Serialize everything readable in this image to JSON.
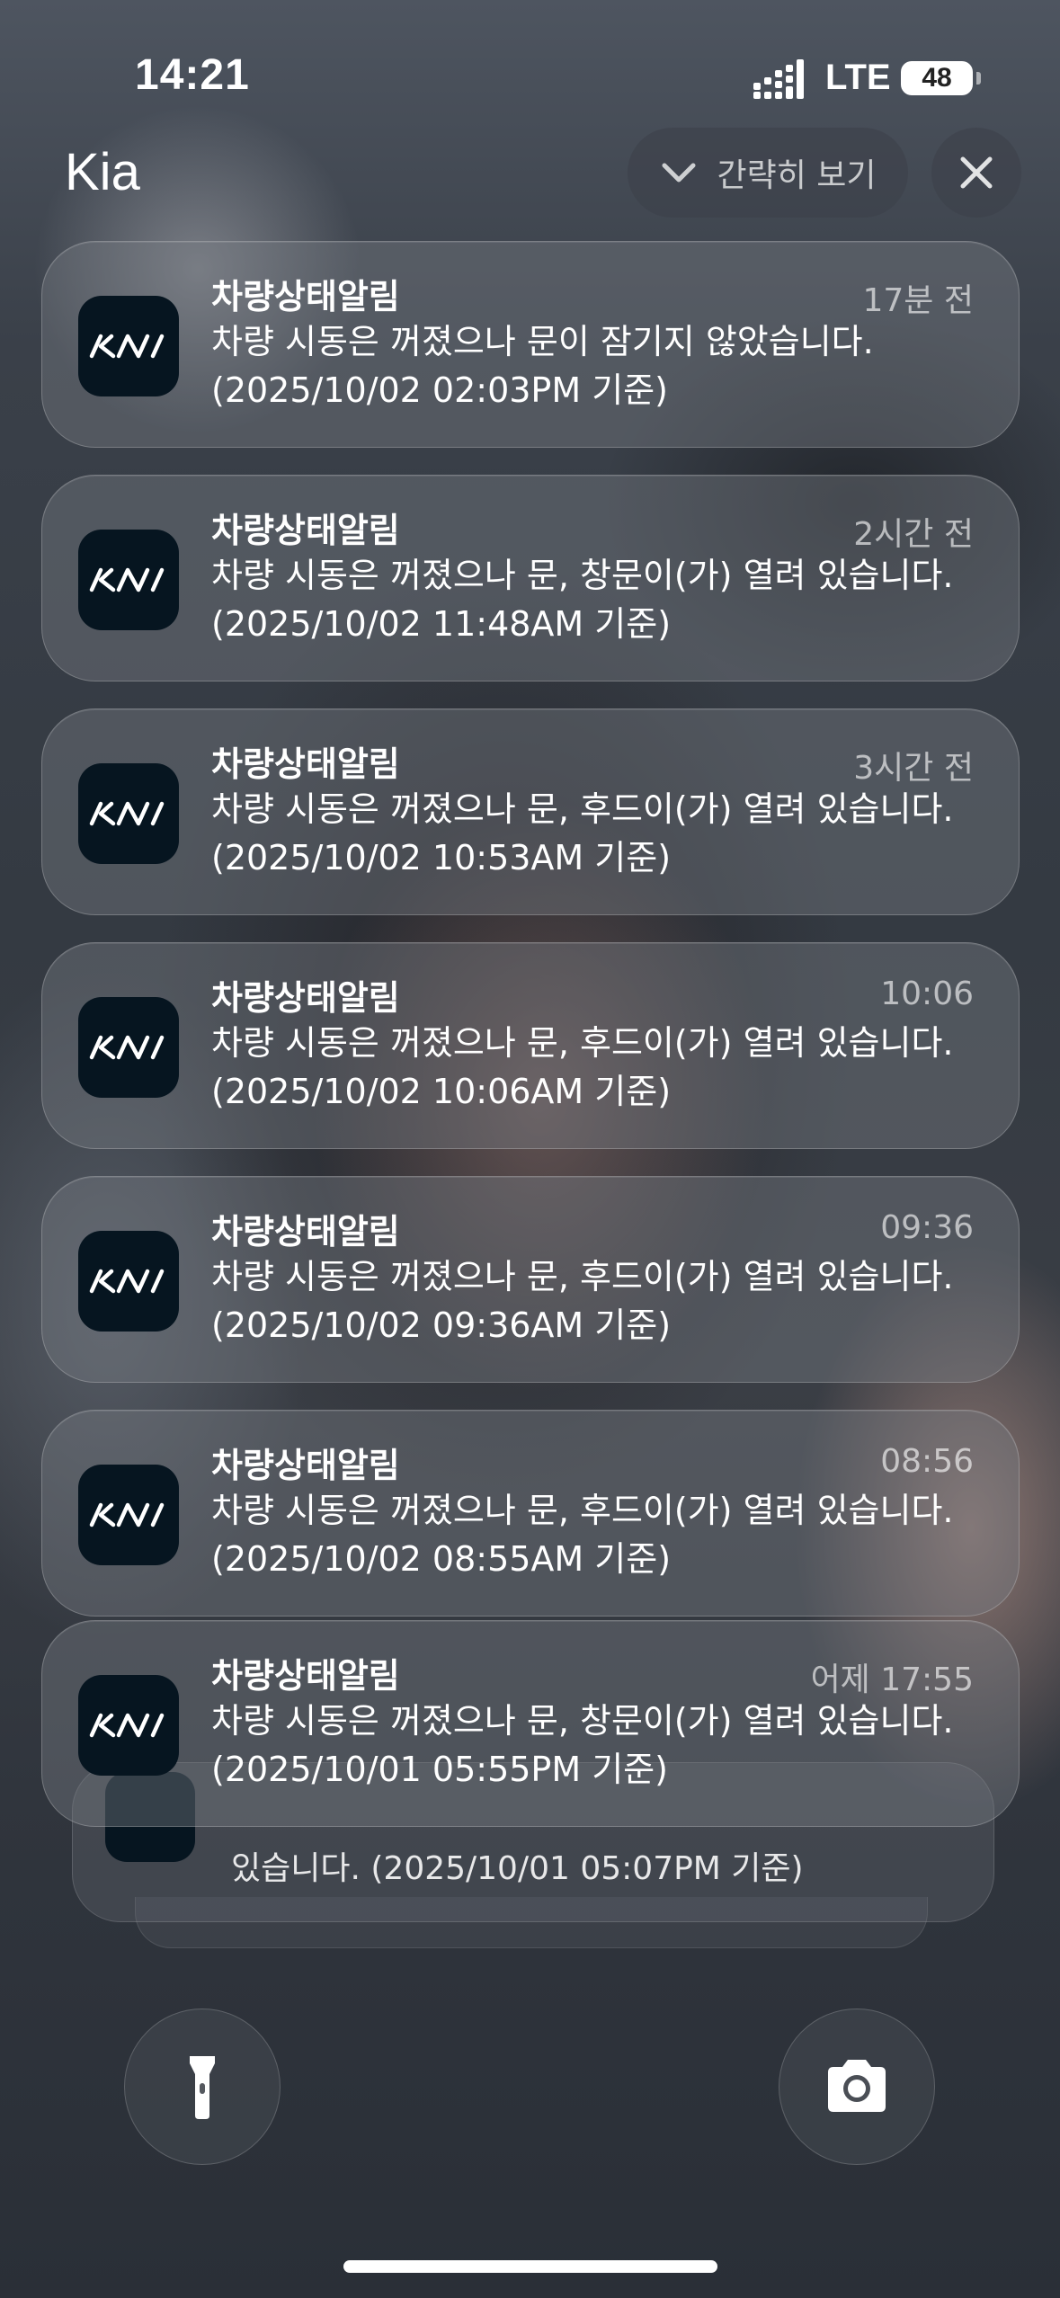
{
  "status_bar": {
    "time": "14:21",
    "network": "LTE",
    "battery": "48"
  },
  "group": {
    "title": "Kia",
    "collapse_label": "간략히 보기",
    "clear_icon": "close-icon"
  },
  "notifications": [
    {
      "app_icon": "kia-logo-icon",
      "title": "차량상태알림",
      "time": "17분 전",
      "body": "차량 시동은 꺼졌으나 문이 잠기지 않았습니다. (2025/10/02 02:03PM 기준)"
    },
    {
      "app_icon": "kia-logo-icon",
      "title": "차량상태알림",
      "time": "2시간 전",
      "body": "차량 시동은 꺼졌으나 문, 창문이(가) 열려 있습니다. (2025/10/02 11:48AM 기준)"
    },
    {
      "app_icon": "kia-logo-icon",
      "title": "차량상태알림",
      "time": "3시간 전",
      "body": "차량 시동은 꺼졌으나 문, 후드이(가) 열려 있습니다. (2025/10/02 10:53AM 기준)"
    },
    {
      "app_icon": "kia-logo-icon",
      "title": "차량상태알림",
      "time": "10:06",
      "body": "차량 시동은 꺼졌으나 문, 후드이(가) 열려 있습니다. (2025/10/02 10:06AM 기준)"
    },
    {
      "app_icon": "kia-logo-icon",
      "title": "차량상태알림",
      "time": "09:36",
      "body": "차량 시동은 꺼졌으나 문, 후드이(가) 열려 있습니다. (2025/10/02 09:36AM 기준)"
    },
    {
      "app_icon": "kia-logo-icon",
      "title": "차량상태알림",
      "time": "08:56",
      "body": "차량 시동은 꺼졌으나 문, 후드이(가) 열려 있습니다. (2025/10/02 08:55AM 기준)"
    },
    {
      "app_icon": "kia-logo-icon",
      "title": "차량상태알림",
      "time": "어제 17:55",
      "body": "차량 시동은 꺼졌으나 문, 창문이(가) 열려 있습니다. (2025/10/01 05:55PM 기준)"
    }
  ],
  "stacked_notification": {
    "body_visible": "있습니다. (2025/10/01 05:07PM 기준)"
  },
  "quick_actions": {
    "left_icon": "flashlight-icon",
    "right_icon": "camera-icon"
  }
}
